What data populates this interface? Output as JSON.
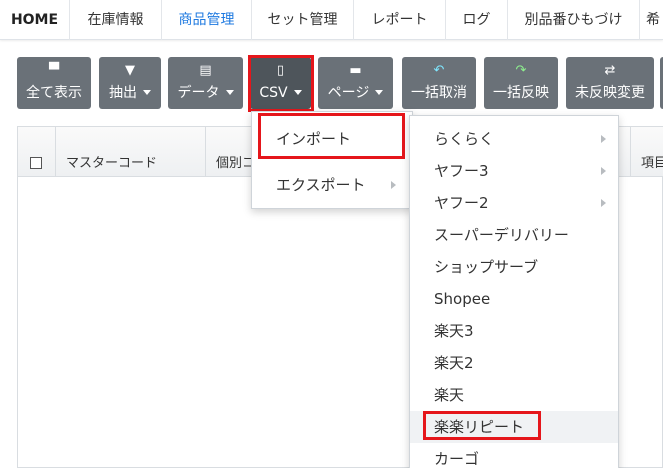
{
  "nav": {
    "tabs": [
      "HOME",
      "在庫情報",
      "商品管理",
      "セット管理",
      "レポート",
      "ログ",
      "別品番ひもづけ",
      "希"
    ]
  },
  "toolbar": {
    "buttons": [
      {
        "label": "全て表示",
        "icon": "box-icon",
        "glyph": "▀"
      },
      {
        "label": "抽出",
        "icon": "filter-icon",
        "glyph": "▼"
      },
      {
        "label": "データ",
        "icon": "file-icon",
        "glyph": "▤"
      },
      {
        "label": "CSV",
        "icon": "csv-file-icon",
        "glyph": "▯"
      },
      {
        "label": "ページ",
        "icon": "store-icon",
        "glyph": "▬"
      },
      {
        "label": "一括取消",
        "icon": "undo-icon",
        "glyph": "↶"
      },
      {
        "label": "一括反映",
        "icon": "redo-icon",
        "glyph": "↷"
      },
      {
        "label": "未反映変更",
        "icon": "swap-icon",
        "glyph": "⇄"
      }
    ]
  },
  "table": {
    "headers": [
      "マスターコード",
      "個別コ",
      "項目"
    ]
  },
  "csv_menu": {
    "items": [
      "インポート",
      "エクスポート"
    ]
  },
  "import_menu": {
    "items": [
      "らくらく",
      "ヤフー3",
      "ヤフー2",
      "スーパーデリバリー",
      "ショップサーブ",
      "Shopee",
      "楽天3",
      "楽天2",
      "楽天",
      "楽楽リピート",
      "カーゴ"
    ]
  },
  "colors": {
    "highlight": "#e5161b",
    "button": "#6a7178",
    "active_tab": "#1f7ae0"
  }
}
